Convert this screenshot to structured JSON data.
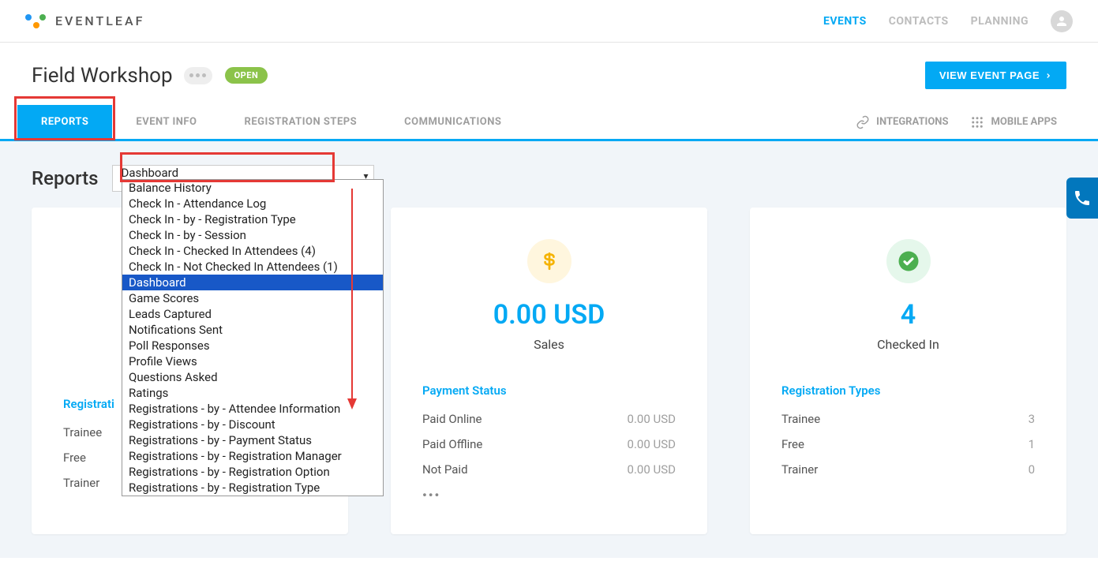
{
  "brand": "EVENTLEAF",
  "topnav": {
    "items": [
      "EVENTS",
      "CONTACTS",
      "PLANNING"
    ],
    "activeIndex": 0
  },
  "event": {
    "title": "Field Workshop",
    "status": "OPEN",
    "viewButton": "VIEW EVENT PAGE"
  },
  "tabs": {
    "items": [
      "REPORTS",
      "EVENT INFO",
      "REGISTRATION STEPS",
      "COMMUNICATIONS"
    ],
    "activeIndex": 0,
    "right": {
      "integrations": "INTEGRATIONS",
      "mobileApps": "MOBILE APPS"
    }
  },
  "reports": {
    "title": "Reports",
    "selected": "Dashboard",
    "options": [
      "Balance History",
      "Check In - Attendance Log",
      "Check In - by - Registration Type",
      "Check In - by - Session",
      "Check In - Checked In Attendees (4)",
      "Check In - Not Checked In Attendees (1)",
      "Dashboard",
      "Game Scores",
      "Leads Captured",
      "Notifications Sent",
      "Poll Responses",
      "Profile Views",
      "Questions Asked",
      "Ratings",
      "Registrations - by - Attendee Information",
      "Registrations - by - Discount",
      "Registrations - by - Payment Status",
      "Registrations - by - Registration Manager",
      "Registrations - by - Registration Option",
      "Registrations - by - Registration Type"
    ],
    "selectedIndex": 6
  },
  "cards": {
    "left": {
      "sectionTitle": "Registrati",
      "rows": [
        {
          "label": "Trainee",
          "value": ""
        },
        {
          "label": "Free",
          "value": ""
        },
        {
          "label": "Trainer",
          "value": ""
        }
      ]
    },
    "sales": {
      "value": "0.00 USD",
      "label": "Sales",
      "sectionTitle": "Payment Status",
      "rows": [
        {
          "label": "Paid Online",
          "value": "0.00 USD"
        },
        {
          "label": "Paid Offline",
          "value": "0.00 USD"
        },
        {
          "label": "Not Paid",
          "value": "0.00 USD"
        }
      ]
    },
    "checkin": {
      "value": "4",
      "label": "Checked In",
      "sectionTitle": "Registration Types",
      "rows": [
        {
          "label": "Trainee",
          "value": "3"
        },
        {
          "label": "Free",
          "value": "1"
        },
        {
          "label": "Trainer",
          "value": "0"
        }
      ]
    }
  }
}
